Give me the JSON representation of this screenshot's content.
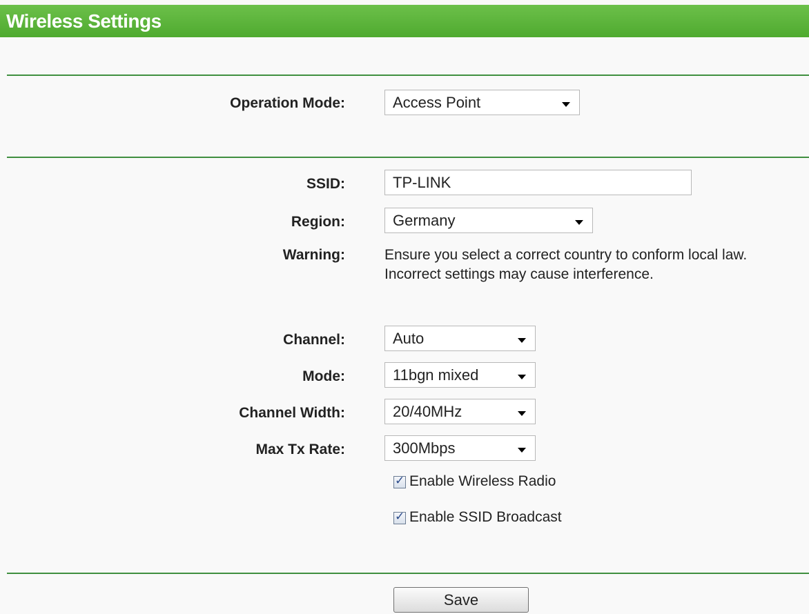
{
  "header": {
    "title": "Wireless Settings"
  },
  "operation_mode": {
    "label": "Operation Mode:",
    "value": "Access Point"
  },
  "ssid": {
    "label": "SSID:",
    "value": "TP-LINK"
  },
  "region": {
    "label": "Region:",
    "value": "Germany"
  },
  "warning": {
    "label": "Warning:",
    "line1": "Ensure you select a correct country to conform local law.",
    "line2": "Incorrect settings may cause interference."
  },
  "channel": {
    "label": "Channel:",
    "value": "Auto"
  },
  "mode": {
    "label": "Mode:",
    "value": "11bgn mixed"
  },
  "channel_width": {
    "label": "Channel Width:",
    "value": "20/40MHz"
  },
  "max_tx_rate": {
    "label": "Max Tx Rate:",
    "value": "300Mbps"
  },
  "enable_wireless_radio": {
    "label": "Enable Wireless Radio",
    "checked": true
  },
  "enable_ssid_broadcast": {
    "label": "Enable SSID Broadcast",
    "checked": true
  },
  "actions": {
    "save_label": "Save"
  },
  "colors": {
    "header_green": "#5ab53a",
    "divider_green": "#3f8f3f"
  }
}
